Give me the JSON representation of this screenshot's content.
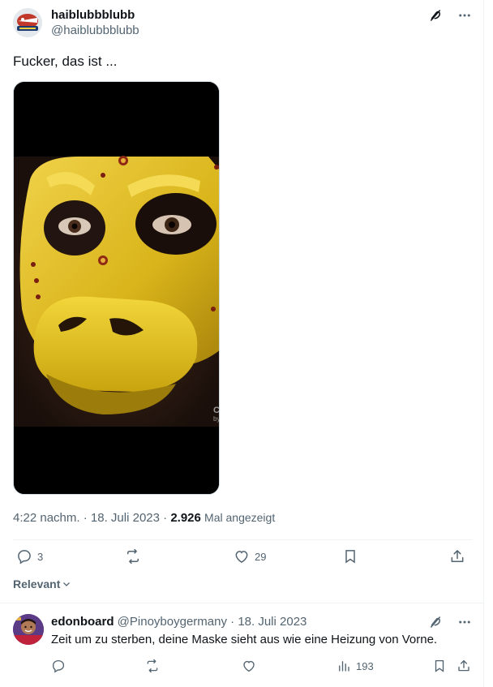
{
  "post": {
    "display_name": "haiblubbblubb",
    "handle": "@haiblubbblubb",
    "text": "Fucker, das ist ...",
    "time": "4:22 nachm.",
    "separator": "·",
    "date": "18. Juli 2023",
    "views_count": "2.926",
    "views_label": "Mal angezeigt",
    "media_watermark": "C\nby"
  },
  "actions": {
    "replies": "3",
    "likes": "29"
  },
  "sort": {
    "label": "Relevant"
  },
  "reply": {
    "name": "edonboard",
    "handle": "@Pinoyboygermany",
    "separator": "·",
    "date": "18. Juli 2023",
    "text": "Zeit um zu sterben, deine Maske sieht aus wie eine Heizung von Vorne.",
    "views": "193"
  },
  "icons": {
    "grok": "grok-icon",
    "more": "more-icon",
    "reply": "reply-icon",
    "repost": "repost-icon",
    "like": "like-icon",
    "bookmark": "bookmark-icon",
    "share": "share-icon",
    "views": "views-icon",
    "chevron": "chevron-down-icon"
  },
  "colors": {
    "text": "#0f1419",
    "secondary": "#536471",
    "divider": "#eff3f4",
    "mask_yellow": "#e5c21c"
  }
}
